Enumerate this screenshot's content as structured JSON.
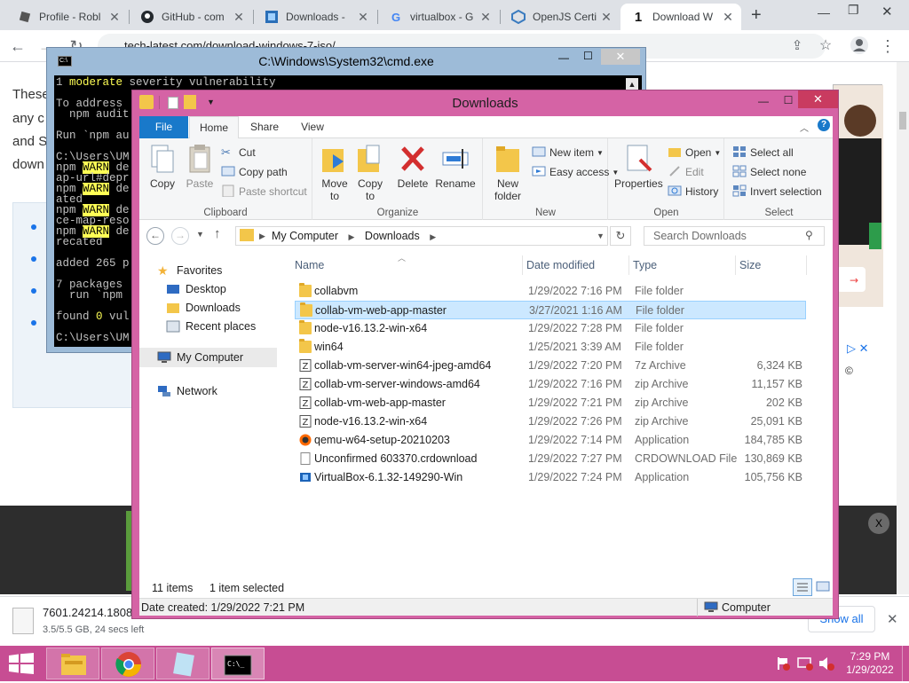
{
  "browser": {
    "tabs": [
      {
        "title": "Profile - Robl",
        "icon": "roblox-icon"
      },
      {
        "title": "GitHub - com",
        "icon": "github-icon"
      },
      {
        "title": "Downloads -",
        "icon": "downloads-icon"
      },
      {
        "title": "virtualbox - G",
        "icon": "google-icon"
      },
      {
        "title": "OpenJS Certi",
        "icon": "openjs-icon"
      },
      {
        "title": "Download W",
        "icon": "techlatest-icon"
      }
    ],
    "url": "tech-latest.com/download-windows-7-iso/"
  },
  "page": {
    "text_lines": [
      "These",
      "any c",
      "and S",
      "down"
    ],
    "download_item": {
      "name": "7601.24214.18080",
      "status": "3.5/5.5 GB, 24 secs left"
    },
    "show_all": "Show all"
  },
  "cmd": {
    "title": "C:\\Windows\\System32\\cmd.exe",
    "lines": [
      [
        "1 ",
        "moderate",
        " severity vulnerability"
      ],
      [
        "",
        "",
        ""
      ],
      [
        "To address",
        "",
        ""
      ],
      [
        "  npm audit",
        "",
        ""
      ],
      [
        "",
        "",
        ""
      ],
      [
        "Run `npm au",
        "",
        ""
      ],
      [
        "",
        "",
        ""
      ],
      [
        "C:\\Users\\UM",
        "",
        ""
      ],
      [
        "npm ",
        "WARN",
        " de"
      ],
      [
        "ap-url#depr",
        "",
        ""
      ],
      [
        "npm ",
        "WARN",
        " de"
      ],
      [
        "ated",
        "",
        ""
      ],
      [
        "npm ",
        "WARN",
        " de"
      ],
      [
        "ce-map-reso",
        "",
        ""
      ],
      [
        "npm ",
        "WARN",
        " de"
      ],
      [
        "recated",
        "",
        ""
      ],
      [
        "",
        "",
        ""
      ],
      [
        "added 265 p",
        "",
        ""
      ],
      [
        "",
        "",
        ""
      ],
      [
        "7 packages",
        "",
        ""
      ],
      [
        "  run `npm",
        "",
        ""
      ],
      [
        "",
        "",
        ""
      ],
      [
        "found ",
        "0",
        " vul"
      ],
      [
        "",
        "",
        ""
      ],
      [
        "C:\\Users\\UM",
        "",
        ""
      ]
    ]
  },
  "explorer": {
    "title": "Downloads",
    "ribbon_tabs": [
      "File",
      "Home",
      "Share",
      "View"
    ],
    "clipboard": {
      "copy": "Copy",
      "paste": "Paste",
      "cut": "Cut",
      "copy_path": "Copy path",
      "paste_shortcut": "Paste shortcut",
      "label": "Clipboard"
    },
    "organize": {
      "move_to": "Move to",
      "copy_to": "Copy to",
      "delete": "Delete",
      "rename": "Rename",
      "label": "Organize"
    },
    "new": {
      "new_folder": "New folder",
      "new_item": "New item",
      "easy_access": "Easy access",
      "label": "New"
    },
    "open": {
      "properties": "Properties",
      "open": "Open",
      "edit": "Edit",
      "history": "History",
      "label": "Open"
    },
    "select": {
      "select_all": "Select all",
      "select_none": "Select none",
      "invert": "Invert selection",
      "label": "Select"
    },
    "breadcrumb": [
      "My Computer",
      "Downloads"
    ],
    "search_placeholder": "Search Downloads",
    "nav": {
      "favorites": "Favorites",
      "desktop": "Desktop",
      "downloads": "Downloads",
      "recent": "Recent places",
      "computer": "My Computer",
      "network": "Network"
    },
    "columns": [
      "Name",
      "Date modified",
      "Type",
      "Size"
    ],
    "files": [
      {
        "name": "collabvm",
        "date": "1/29/2022 7:16 PM",
        "type": "File folder",
        "size": "",
        "icon": "folder-icon"
      },
      {
        "name": "collab-vm-web-app-master",
        "date": "3/27/2021 1:16 AM",
        "type": "File folder",
        "size": "",
        "icon": "folder-icon"
      },
      {
        "name": "node-v16.13.2-win-x64",
        "date": "1/29/2022 7:28 PM",
        "type": "File folder",
        "size": "",
        "icon": "folder-icon"
      },
      {
        "name": "win64",
        "date": "1/25/2021 3:39 AM",
        "type": "File folder",
        "size": "",
        "icon": "folder-icon"
      },
      {
        "name": "collab-vm-server-win64-jpeg-amd64",
        "date": "1/29/2022 7:20 PM",
        "type": "7z Archive",
        "size": "6,324 KB",
        "icon": "archive-icon"
      },
      {
        "name": "collab-vm-server-windows-amd64",
        "date": "1/29/2022 7:16 PM",
        "type": "zip Archive",
        "size": "11,157 KB",
        "icon": "archive-icon"
      },
      {
        "name": "collab-vm-web-app-master",
        "date": "1/29/2022 7:21 PM",
        "type": "zip Archive",
        "size": "202 KB",
        "icon": "archive-icon"
      },
      {
        "name": "node-v16.13.2-win-x64",
        "date": "1/29/2022 7:26 PM",
        "type": "zip Archive",
        "size": "25,091 KB",
        "icon": "archive-icon"
      },
      {
        "name": "qemu-w64-setup-20210203",
        "date": "1/29/2022 7:14 PM",
        "type": "Application",
        "size": "184,785 KB",
        "icon": "qemu-icon"
      },
      {
        "name": "Unconfirmed 603370.crdownload",
        "date": "1/29/2022 7:27 PM",
        "type": "CRDOWNLOAD File",
        "size": "130,869 KB",
        "icon": "blank-file-icon"
      },
      {
        "name": "VirtualBox-6.1.32-149290-Win",
        "date": "1/29/2022 7:24 PM",
        "type": "Application",
        "size": "105,756 KB",
        "icon": "virtualbox-icon"
      }
    ],
    "selected_index": 1,
    "status_items": "11 items",
    "status_selected": "1 item selected",
    "date_created": "Date created: 1/29/2022 7:21 PM",
    "location": "Computer"
  },
  "taskbar": {
    "time": "7:29 PM",
    "date": "1/29/2022"
  },
  "colors": {
    "explorer_frame": "#d563a5",
    "taskbar": "#c74d93",
    "selection": "#cce8ff"
  }
}
